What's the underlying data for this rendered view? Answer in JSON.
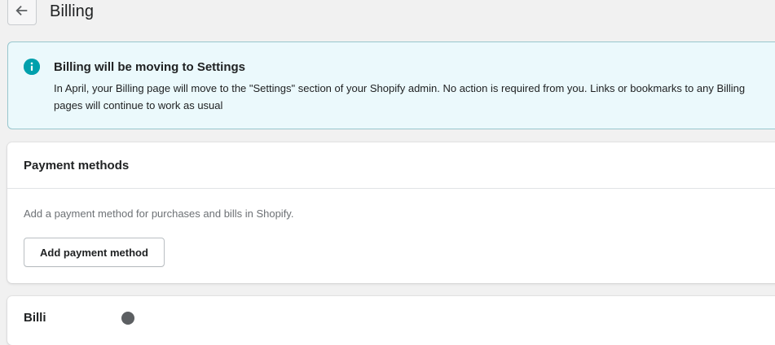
{
  "header": {
    "back_icon": "arrow-left-icon",
    "title": "Billing"
  },
  "banner": {
    "icon": "info-icon",
    "accent_color": "#00a0ac",
    "title": "Billing will be moving to Settings",
    "text": "In April, your Billing page will move to the \"Settings\" section of your Shopify admin. No action is required from you. Links or bookmarks to any Billing pages will continue to work as usual"
  },
  "payment_methods": {
    "title": "Payment methods",
    "description": "Add a payment method for purchases and bills in Shopify.",
    "add_button_label": "Add payment method"
  },
  "next_section": {
    "title_visible": "Billi",
    "icon": "help-icon"
  }
}
